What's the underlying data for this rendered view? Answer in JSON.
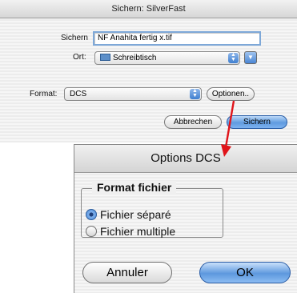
{
  "save_dialog": {
    "title": "Sichern: SilverFast",
    "name_label": "Sichern",
    "name_value": "NF Anahita fertig x.tif",
    "location_label": "Ort:",
    "location_value": "Schreibtisch",
    "format_label": "Format:",
    "format_value": "DCS",
    "options_button": "Optionen..",
    "cancel_button": "Abbrechen",
    "save_button": "Sichern"
  },
  "options_dialog": {
    "title": "Options DCS",
    "group_title": "Format fichier",
    "radio_separate": "Fichier séparé",
    "radio_multiple": "Fichier multiple",
    "selected": "separate",
    "cancel_button": "Annuler",
    "ok_button": "OK"
  },
  "colors": {
    "arrow": "#e0141a",
    "accent_blue": "#5f9be0"
  }
}
